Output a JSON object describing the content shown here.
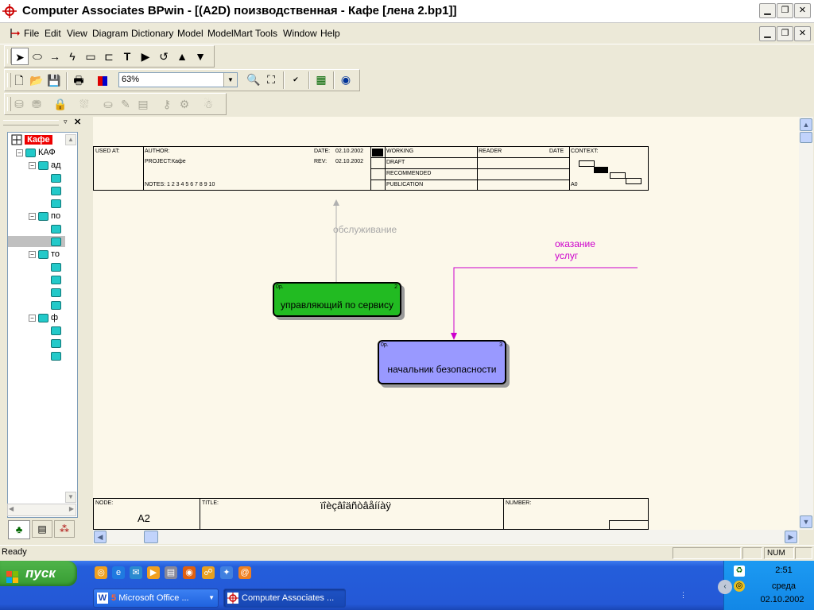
{
  "window": {
    "title": "Computer Associates BPwin - [(A2D) поизводственная - Кафе  [лена 2.bp1]]"
  },
  "menu": {
    "items": [
      "File",
      "Edit",
      "View",
      "Diagram",
      "Dictionary",
      "Model",
      "ModelMart",
      "Tools",
      "Window",
      "Help"
    ]
  },
  "toolbar": {
    "zoom_value": "63%"
  },
  "tree": {
    "root_label": "Кафе",
    "nodes": [
      {
        "label": "КАФ"
      },
      {
        "label": "ад"
      },
      {
        "label": ""
      },
      {
        "label": ""
      },
      {
        "label": ""
      },
      {
        "label": "по"
      },
      {
        "label": ""
      },
      {
        "label": ""
      },
      {
        "label": "то"
      },
      {
        "label": ""
      },
      {
        "label": ""
      },
      {
        "label": ""
      },
      {
        "label": ""
      },
      {
        "label": "ф"
      },
      {
        "label": ""
      },
      {
        "label": ""
      },
      {
        "label": ""
      }
    ]
  },
  "form_header": {
    "used_at": "USED AT:",
    "author": "AUTHOR:",
    "project_label": "PROJECT:",
    "project_value": "Кафе",
    "notes": "NOTES:  1  2  3  4  5  6  7  8  9  10",
    "date_label": "DATE:",
    "date_value": "02.10.2002",
    "rev_label": "REV:",
    "rev_value": "02.10.2002",
    "working": "WORKING",
    "draft": "DRAFT",
    "recommended": "RECOMMENDED",
    "publication": "PUBLICATION",
    "reader": "READER",
    "reader_date": "DATE",
    "context": "CONTEXT:",
    "context_node": "A0"
  },
  "form_footer": {
    "node_label": "NODE:",
    "node_value": "A2",
    "title_label": "TITLE:",
    "title_value": "ïîèçâîäñòâåííàÿ",
    "number_label": "NUMBER:"
  },
  "diagram": {
    "arrow_label_1": "обслуживание",
    "arrow_label_2a": "оказание",
    "arrow_label_2b": "услуг",
    "box1": {
      "label": "управляющий по сервису",
      "tag": "0р.",
      "number": "2",
      "color": "#22bb22"
    },
    "box2": {
      "label": "начальник безопасности",
      "tag": "0р.",
      "number": "3",
      "color": "#9999ff"
    }
  },
  "status": {
    "text": "Ready",
    "num": "NUM"
  },
  "taskbar": {
    "start_label": "пуск",
    "task1": "Microsoft Office ...",
    "task1_count": "5",
    "task2": "Computer Associates ...",
    "clock_time": "2:51",
    "clock_day": "среда",
    "clock_date": "02.10.2002"
  }
}
